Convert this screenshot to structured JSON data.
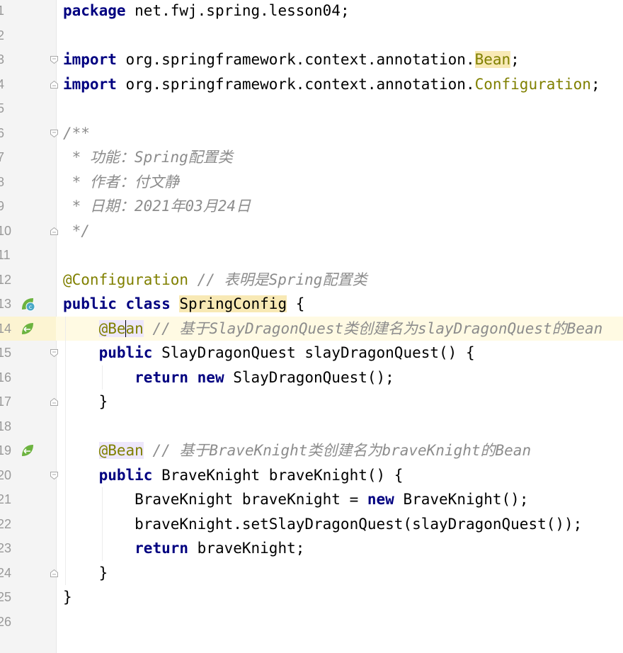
{
  "editor": {
    "current_line": 14,
    "line_numbers": [
      "1",
      "2",
      "3",
      "4",
      "5",
      "6",
      "7",
      "8",
      "9",
      "10",
      "11",
      "12",
      "13",
      "14",
      "15",
      "16",
      "17",
      "18",
      "19",
      "20",
      "21",
      "22",
      "23",
      "24",
      "25",
      "26"
    ],
    "lines": [
      {
        "segments": [
          {
            "t": "package",
            "c": "kw"
          },
          {
            "t": " net.fwj.spring.lesson04;"
          }
        ]
      },
      {
        "segments": []
      },
      {
        "segments": [
          {
            "t": "import",
            "c": "kw"
          },
          {
            "t": " org.springframework.context.annotation."
          },
          {
            "t": "Bean",
            "c": "ann hl-yellow"
          },
          {
            "t": ";"
          }
        ]
      },
      {
        "segments": [
          {
            "t": "import",
            "c": "kw"
          },
          {
            "t": " org.springframework.context.annotation."
          },
          {
            "t": "Configuration",
            "c": "ann"
          },
          {
            "t": ";"
          }
        ]
      },
      {
        "segments": []
      },
      {
        "segments": [
          {
            "t": "/**",
            "c": "doc"
          }
        ]
      },
      {
        "segments": [
          {
            "t": " * 功能：Spring配置类",
            "c": "doc"
          }
        ]
      },
      {
        "segments": [
          {
            "t": " * 作者：付文静",
            "c": "doc"
          }
        ]
      },
      {
        "segments": [
          {
            "t": " * 日期：2021年03月24日",
            "c": "doc"
          }
        ]
      },
      {
        "segments": [
          {
            "t": " */",
            "c": "doc"
          }
        ]
      },
      {
        "segments": []
      },
      {
        "segments": [
          {
            "t": "@Configuration",
            "c": "ann"
          },
          {
            "t": " // 表明是Spring配置类",
            "c": "cmt"
          }
        ]
      },
      {
        "segments": [
          {
            "t": "public class",
            "c": "kw"
          },
          {
            "t": " "
          },
          {
            "t": "SpringConfig",
            "c": "hl-cls"
          },
          {
            "t": " {"
          }
        ]
      },
      {
        "segments": [
          {
            "t": "    "
          },
          {
            "t": "@Be",
            "c": "ann hl-purple"
          },
          {
            "t": "|",
            "c": "caret"
          },
          {
            "t": "an",
            "c": "ann hl-purple"
          },
          {
            "t": " // 基于SlayDragonQuest类创建名为slayDragonQuest的Bean",
            "c": "cmt"
          }
        ]
      },
      {
        "segments": [
          {
            "t": "    "
          },
          {
            "t": "public",
            "c": "kw"
          },
          {
            "t": " SlayDragonQuest slayDragonQuest() {"
          }
        ]
      },
      {
        "segments": [
          {
            "t": "        "
          },
          {
            "t": "return new",
            "c": "kw"
          },
          {
            "t": " SlayDragonQuest();"
          }
        ]
      },
      {
        "segments": [
          {
            "t": "    }"
          }
        ]
      },
      {
        "segments": []
      },
      {
        "segments": [
          {
            "t": "    "
          },
          {
            "t": "@Bean",
            "c": "ann hl-purple"
          },
          {
            "t": " // 基于BraveKnight类创建名为braveKnight的Bean",
            "c": "cmt"
          }
        ]
      },
      {
        "segments": [
          {
            "t": "    "
          },
          {
            "t": "public",
            "c": "kw"
          },
          {
            "t": " BraveKnight braveKnight() {"
          }
        ]
      },
      {
        "segments": [
          {
            "t": "        BraveKnight braveKnight = "
          },
          {
            "t": "new",
            "c": "kw"
          },
          {
            "t": " BraveKnight();"
          }
        ]
      },
      {
        "segments": [
          {
            "t": "        braveKnight.setSlayDragonQuest(slayDragonQuest());"
          }
        ]
      },
      {
        "segments": [
          {
            "t": "        "
          },
          {
            "t": "return",
            "c": "kw"
          },
          {
            "t": " braveKnight;"
          }
        ]
      },
      {
        "segments": [
          {
            "t": "    }"
          }
        ]
      },
      {
        "segments": [
          {
            "t": "}"
          }
        ]
      },
      {
        "segments": []
      }
    ]
  },
  "gutter_icons": [
    {
      "line": 13,
      "icon": "spring-config-icon",
      "color": "#6cb33f"
    },
    {
      "line": 14,
      "icon": "spring-bean-navigate-icon",
      "color": "#6cb33f"
    },
    {
      "line": 19,
      "icon": "spring-bean-icon",
      "color": "#6cb33f"
    }
  ],
  "fold_markers": [
    {
      "line": 3,
      "type": "open"
    },
    {
      "line": 4,
      "type": "close"
    },
    {
      "line": 6,
      "type": "open"
    },
    {
      "line": 10,
      "type": "close"
    },
    {
      "line": 15,
      "type": "open"
    },
    {
      "line": 17,
      "type": "close"
    },
    {
      "line": 20,
      "type": "open"
    },
    {
      "line": 24,
      "type": "close"
    }
  ]
}
